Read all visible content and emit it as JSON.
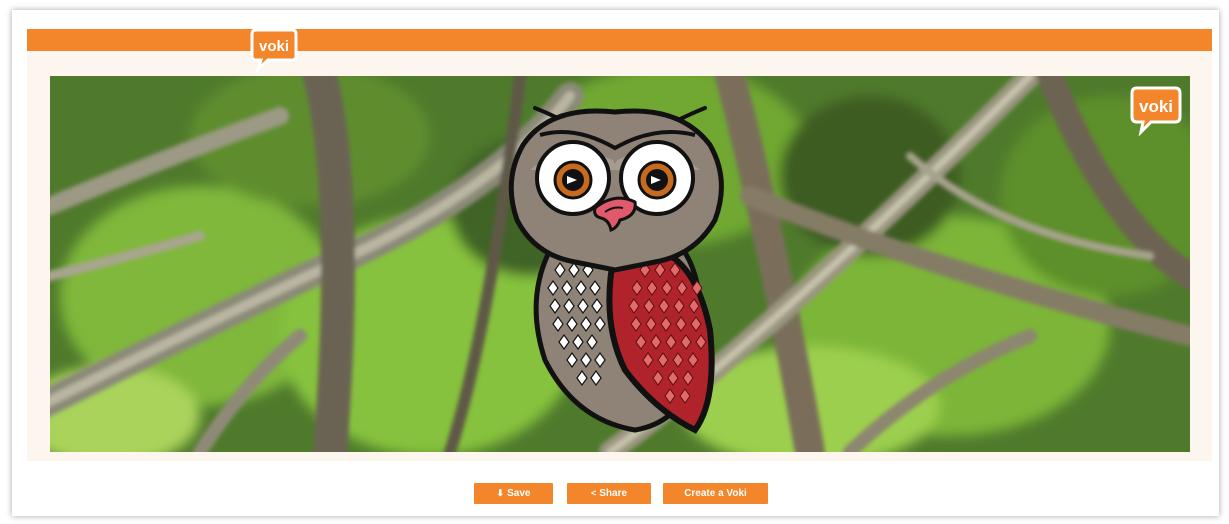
{
  "header": {
    "logo_text": "voki",
    "bar_color": "#f3852a"
  },
  "scene": {
    "logo_text": "voki",
    "background": "forest-branches",
    "character": "owl"
  },
  "actions": {
    "save_label": "Save",
    "save_icon": "download-icon",
    "share_label": "Share",
    "share_icon": "share-icon",
    "create_label": "Create a Voki"
  },
  "colors": {
    "accent": "#f3852a",
    "owl_wing": "#b0232a",
    "owl_body": "#8f8378"
  }
}
